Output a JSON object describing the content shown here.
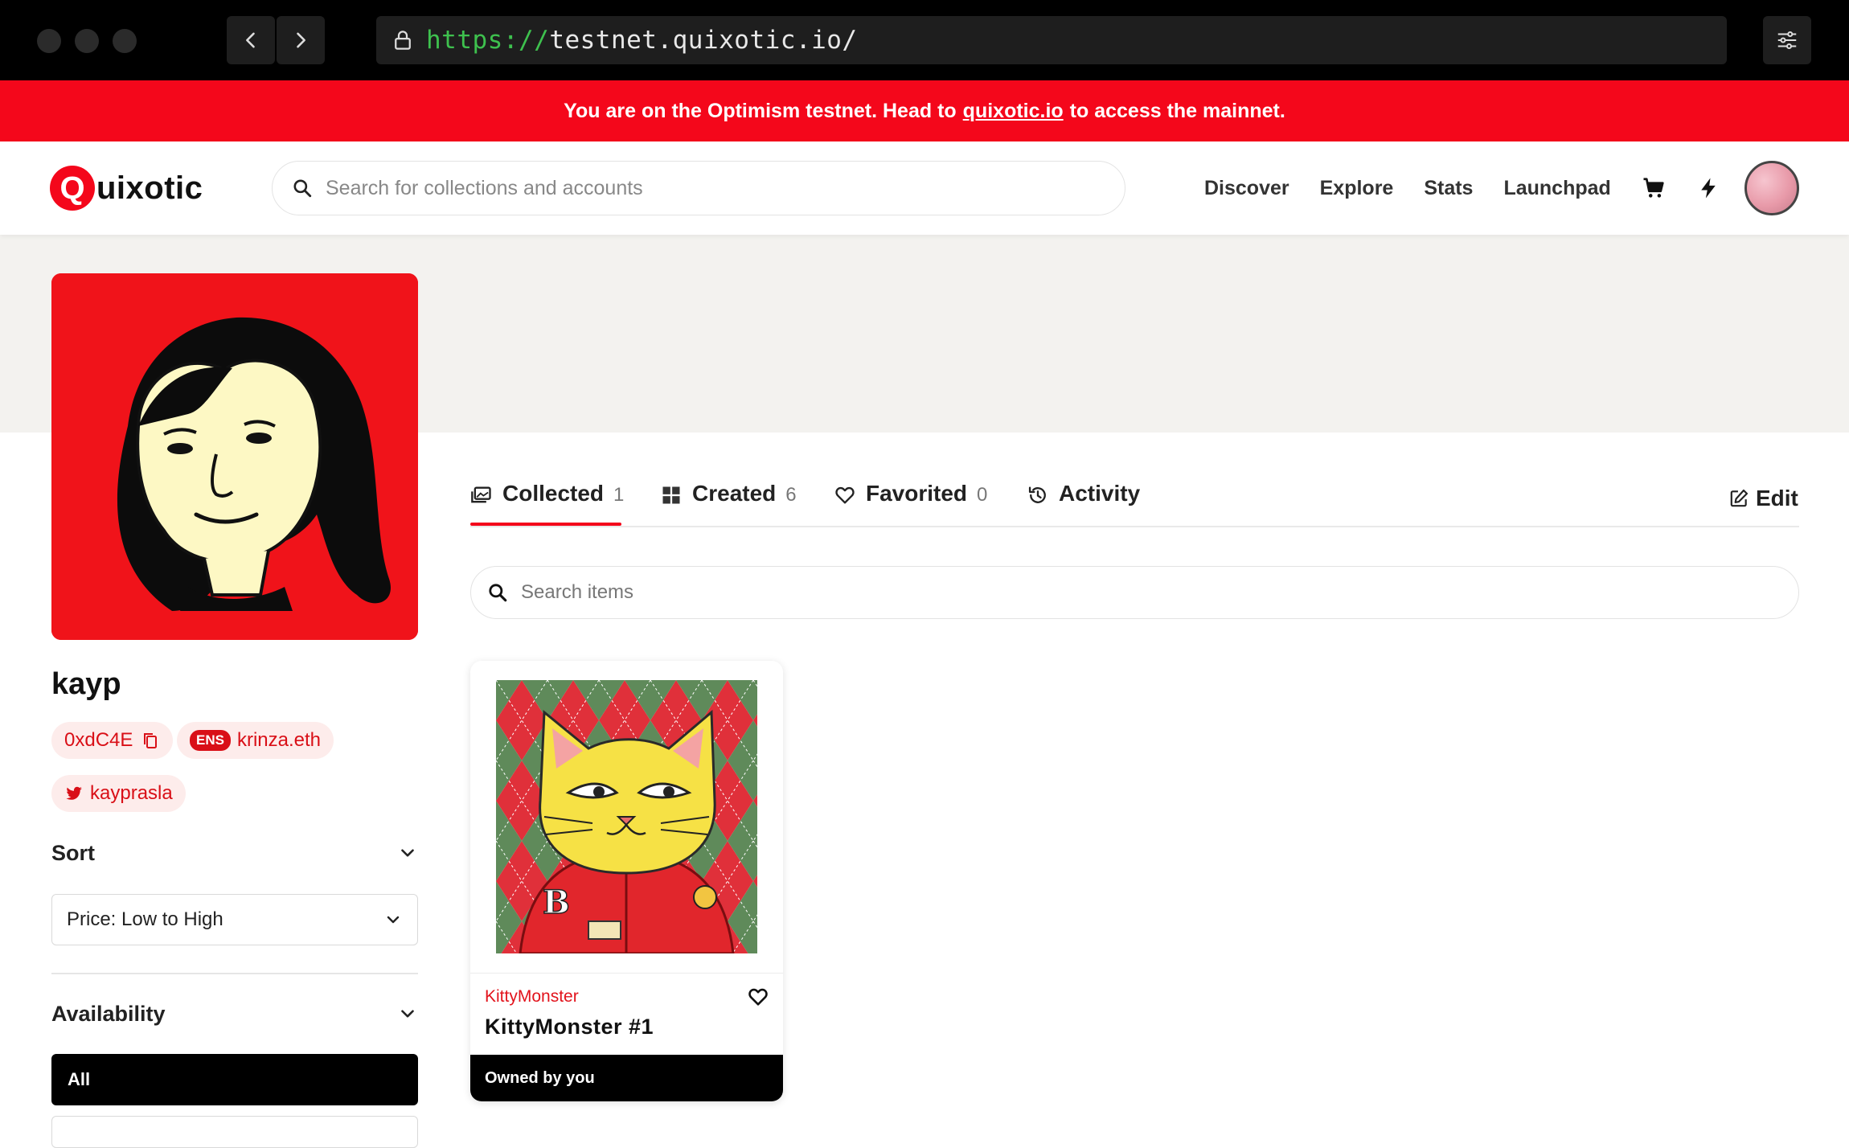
{
  "browser": {
    "url_scheme": "https://",
    "url_rest": "testnet.quixotic.io/"
  },
  "banner": {
    "text_before": "You are on the Optimism testnet. Head to",
    "link": "quixotic.io",
    "text_after": "to access the mainnet."
  },
  "header": {
    "logo_q": "Q",
    "logo_rest": "uixotic",
    "search_placeholder": "Search for collections and accounts",
    "nav": [
      "Discover",
      "Explore",
      "Stats",
      "Launchpad"
    ]
  },
  "profile": {
    "username": "kayp",
    "address": "0xdC4E",
    "ens_badge": "ENS",
    "ens_name": "krinza.eth",
    "twitter": "kayprasla"
  },
  "filters": {
    "sort_title": "Sort",
    "sort_value": "Price: Low to High",
    "availability_title": "Availability",
    "availability_selected": "All"
  },
  "tabs": [
    {
      "label": "Collected",
      "count": "1"
    },
    {
      "label": "Created",
      "count": "6"
    },
    {
      "label": "Favorited",
      "count": "0"
    },
    {
      "label": "Activity",
      "count": ""
    }
  ],
  "edit_label": "Edit",
  "item_search_placeholder": "Search items",
  "card": {
    "collection": "KittyMonster",
    "title": "KittyMonster #1",
    "owner": "Owned by you"
  },
  "colors": {
    "accent": "#f4071b",
    "profile_bg": "#f0131a"
  }
}
